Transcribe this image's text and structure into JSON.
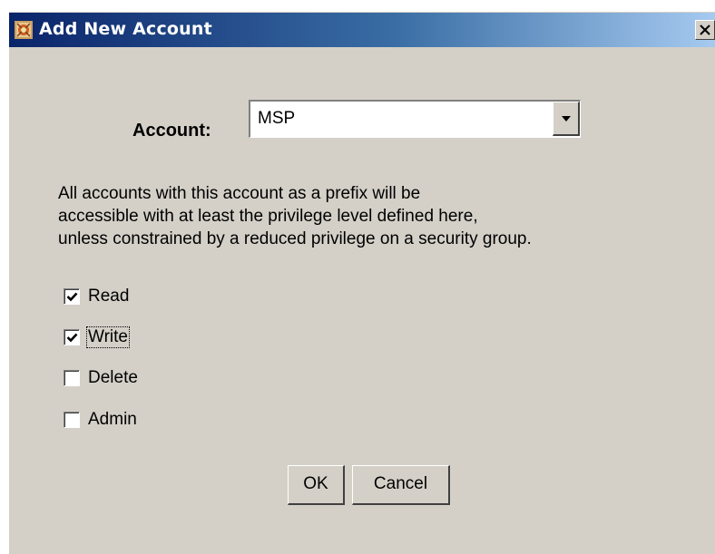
{
  "dialog": {
    "title": "Add New Account",
    "icon": "app-icon",
    "close_label": "X"
  },
  "account": {
    "label": "Account:",
    "value": "MSP"
  },
  "description": {
    "line1": "All accounts with this account as a prefix will be",
    "line2": "accessible with at least the privilege level defined here,",
    "line3": "unless constrained by a reduced privilege on a security group."
  },
  "permissions": [
    {
      "label": "Read",
      "checked": true
    },
    {
      "label": "Write",
      "checked": true,
      "focused": true
    },
    {
      "label": "Delete",
      "checked": false
    },
    {
      "label": "Admin",
      "checked": false
    }
  ],
  "buttons": {
    "ok_label": "OK",
    "cancel_label": "Cancel"
  },
  "colors": {
    "title_start": "#0a246a",
    "title_end": "#a6caf0",
    "face": "#d4d0c8"
  }
}
